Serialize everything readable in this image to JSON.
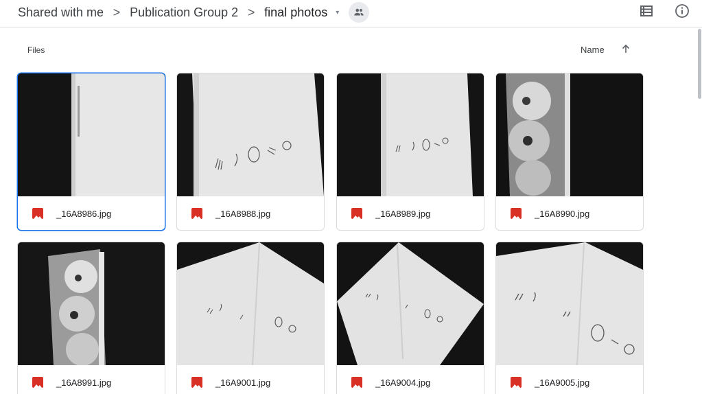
{
  "breadcrumb": {
    "items": [
      "Shared with me",
      "Publication Group 2",
      "final photos"
    ],
    "separator": ">",
    "caret": "▾"
  },
  "header": {
    "shared_icon": "people-icon",
    "list_view_icon": "list-view-icon",
    "info_icon": "info-icon"
  },
  "section": {
    "label": "Files"
  },
  "sort": {
    "label": "Name",
    "direction_icon": "arrow-up-icon"
  },
  "colors": {
    "accent": "#1a73e8",
    "image_file": "#d93025",
    "border": "#dadce0"
  },
  "files": [
    {
      "name": "_16A8986.jpg",
      "selected": true
    },
    {
      "name": "_16A8988.jpg"
    },
    {
      "name": "_16A8989.jpg"
    },
    {
      "name": "_16A8990.jpg"
    },
    {
      "name": "_16A8991.jpg"
    },
    {
      "name": "_16A9001.jpg"
    },
    {
      "name": "_16A9004.jpg"
    },
    {
      "name": "_16A9005.jpg"
    }
  ]
}
